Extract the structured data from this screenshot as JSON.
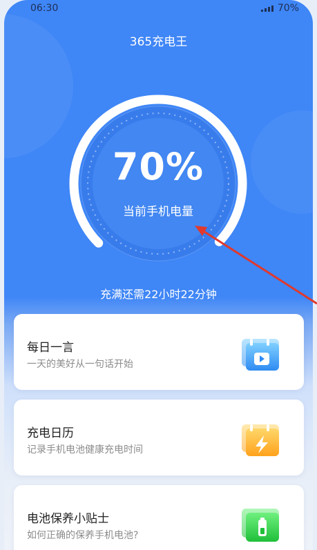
{
  "status_bar": {
    "time": "06:30",
    "battery": "70%"
  },
  "app": {
    "title": "365充电王"
  },
  "battery": {
    "level_percent": 70,
    "level_text": "70%",
    "label": "当前手机电量",
    "remaining_text": "充满还需22小时22分钟"
  },
  "cards": [
    {
      "title": "每日一言",
      "subtitle": "一天的美好从一句话开始",
      "icon": "calendar-video-icon",
      "color": "#4fa9f7"
    },
    {
      "title": "充电日历",
      "subtitle": "记录手机电池健康充电时间",
      "icon": "calendar-lightning-icon",
      "color": "#ffb938"
    },
    {
      "title": "电池保养小贴士",
      "subtitle": "如何正确的保养手机电池?",
      "icon": "battery-tips-icon",
      "color": "#2ecc4a"
    }
  ],
  "colors": {
    "primary": "#3f86f6",
    "annotation_arrow": "#e0392d"
  }
}
